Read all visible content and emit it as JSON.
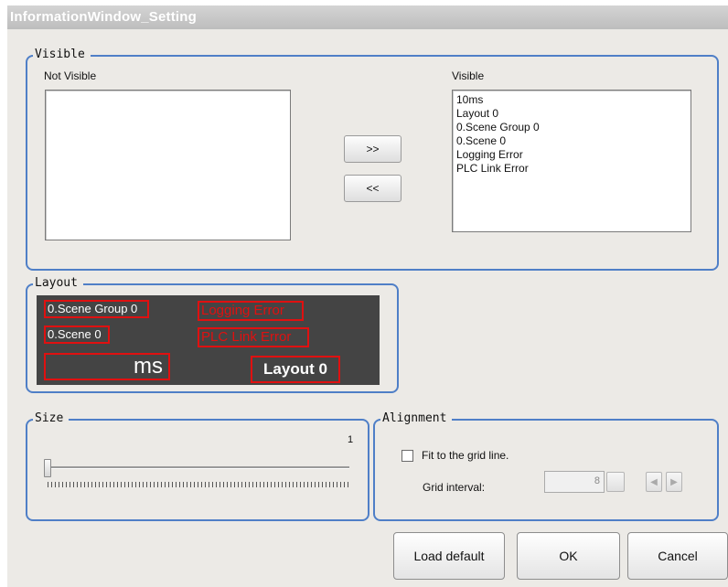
{
  "window": {
    "title": "InformationWindow_Setting"
  },
  "visible_group": {
    "label": "Visible",
    "not_visible_label": "Not Visible",
    "visible_label": "Visible",
    "not_visible_items": [],
    "visible_items": [
      "10ms",
      "Layout 0",
      "0.Scene Group 0",
      "0.Scene 0",
      "Logging Error",
      "PLC Link Error"
    ],
    "move_right_label": ">>",
    "move_left_label": "<<"
  },
  "layout_group": {
    "label": "Layout",
    "preview": {
      "scene_group": "0.Scene Group 0",
      "logging_error": "Logging Error",
      "scene": "0.Scene 0",
      "plc_link_error": "PLC Link Error",
      "time": "ms",
      "layout": "Layout 0"
    }
  },
  "size_group": {
    "label": "Size",
    "value": "1",
    "slider_fraction": 0.0
  },
  "alignment_group": {
    "label": "Alignment",
    "fit_label": "Fit to the grid line.",
    "fit_checked": false,
    "grid_interval_label": "Grid interval:",
    "grid_interval_value": "8"
  },
  "buttons": {
    "load_default": "Load default",
    "ok": "OK",
    "cancel": "Cancel"
  },
  "colors": {
    "group_border": "#4f7fc7",
    "preview_bg": "#444444",
    "preview_outline": "#e01010"
  }
}
